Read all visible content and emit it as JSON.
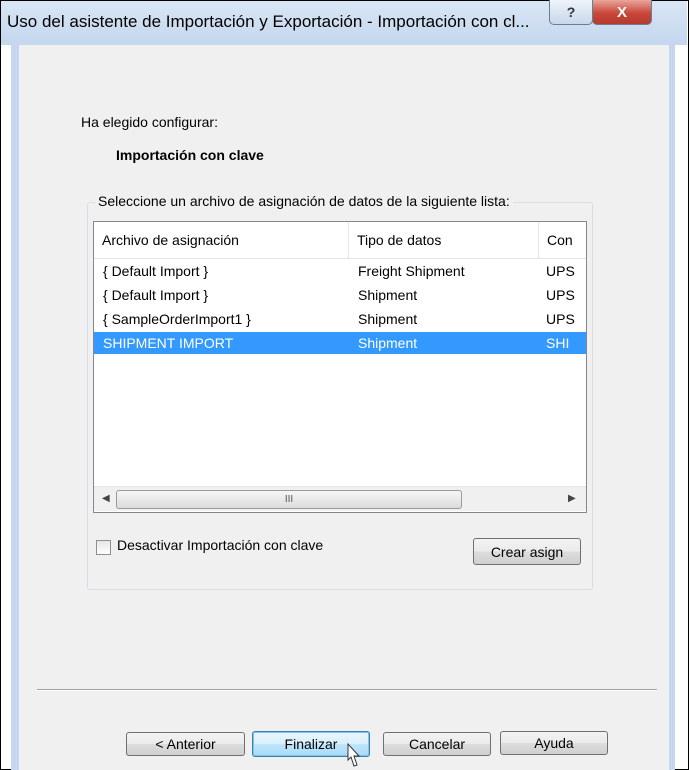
{
  "window": {
    "title": "Uso del asistente de Importación y Exportación - Importación con cl...",
    "help_glyph": "?",
    "close_glyph": "X"
  },
  "content": {
    "intro_label": "Ha elegido configurar:",
    "selected_option": "Importación con clave",
    "group_label": "Seleccione un archivo de asignación de datos de la siguiente lista:"
  },
  "list": {
    "columns": [
      "Archivo de asignación",
      "Tipo de datos",
      "Con"
    ],
    "rows": [
      {
        "name": "{ Default Import }",
        "type": "Freight Shipment",
        "con": "UPS",
        "selected": false
      },
      {
        "name": "{ Default Import }",
        "type": "Shipment",
        "con": "UPS",
        "selected": false
      },
      {
        "name": "{ SampleOrderImport1 }",
        "type": "Shipment",
        "con": "UPS",
        "selected": false
      },
      {
        "name": "SHIPMENT IMPORT",
        "type": "Shipment",
        "con": "SHI",
        "selected": true
      }
    ],
    "scroll_grip": "III"
  },
  "options": {
    "disable_keyed_label": "Desactivar Importación con clave",
    "disable_keyed_checked": false,
    "create_map_label": "Crear asign"
  },
  "footer": {
    "back_label": "< Anterior",
    "finish_label": "Finalizar",
    "cancel_label": "Cancelar",
    "help_label": "Ayuda"
  }
}
